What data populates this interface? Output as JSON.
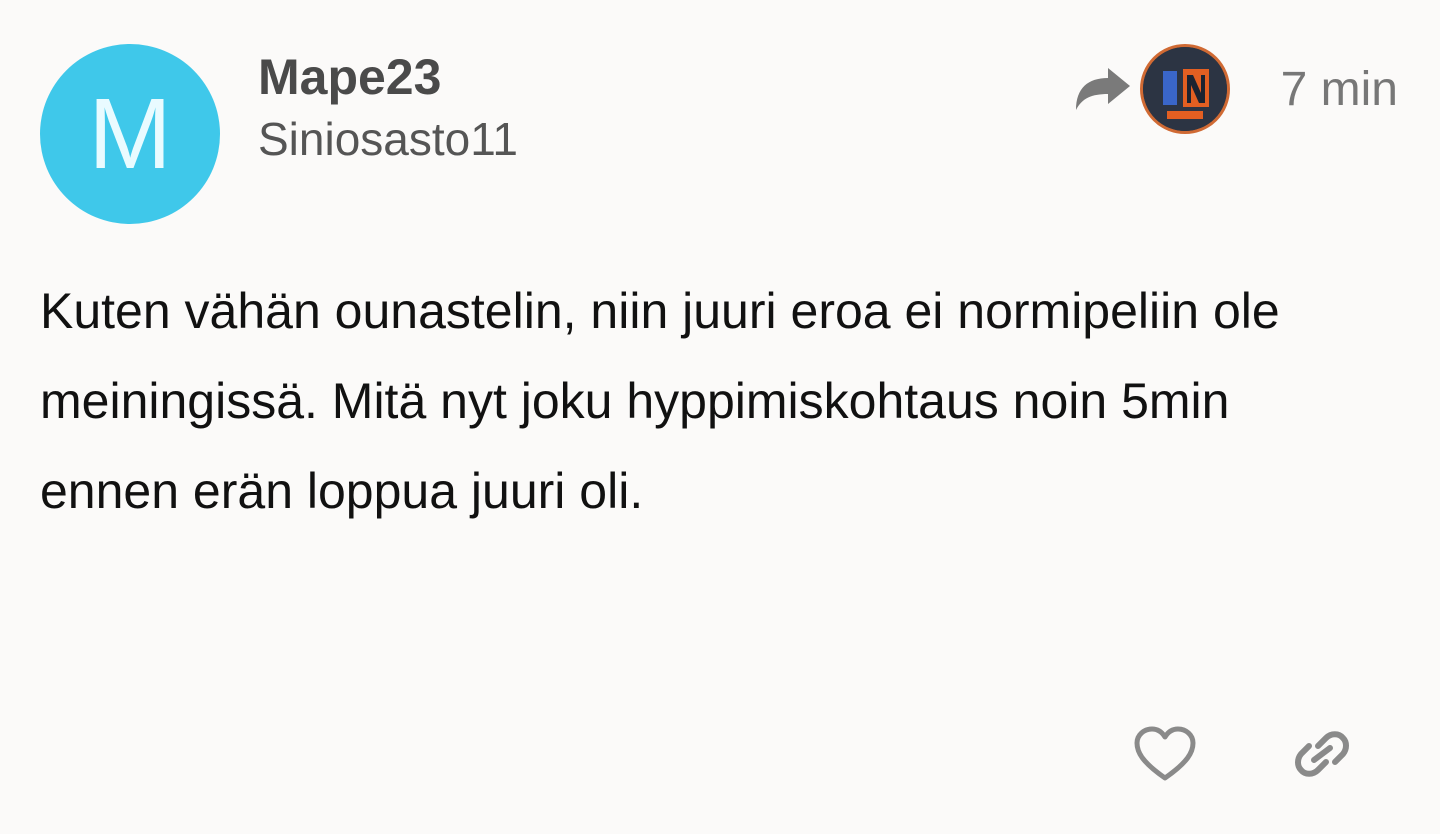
{
  "post": {
    "avatar_letter": "M",
    "username": "Mape23",
    "full_name": "Siniosasto11",
    "reply_icon": "reply-arrow-icon",
    "reply_to_avatar_icon": "user-avatar-badge",
    "timestamp": "7 min",
    "body": "Kuten vähän ounastelin, niin juuri eroa ei normipeliin ole meiningissä. Mitä nyt joku hyppimiskohtaus noin 5min ennen erän loppua juuri oli.",
    "actions": {
      "like_icon": "heart-icon",
      "link_icon": "link-icon"
    }
  },
  "colors": {
    "background": "#fbfaf9",
    "avatar": "#3fc8ea",
    "avatar_letter": "#e9fbff",
    "icon_gray": "#8a8a8a",
    "reply_avatar_border": "#d06a34"
  }
}
